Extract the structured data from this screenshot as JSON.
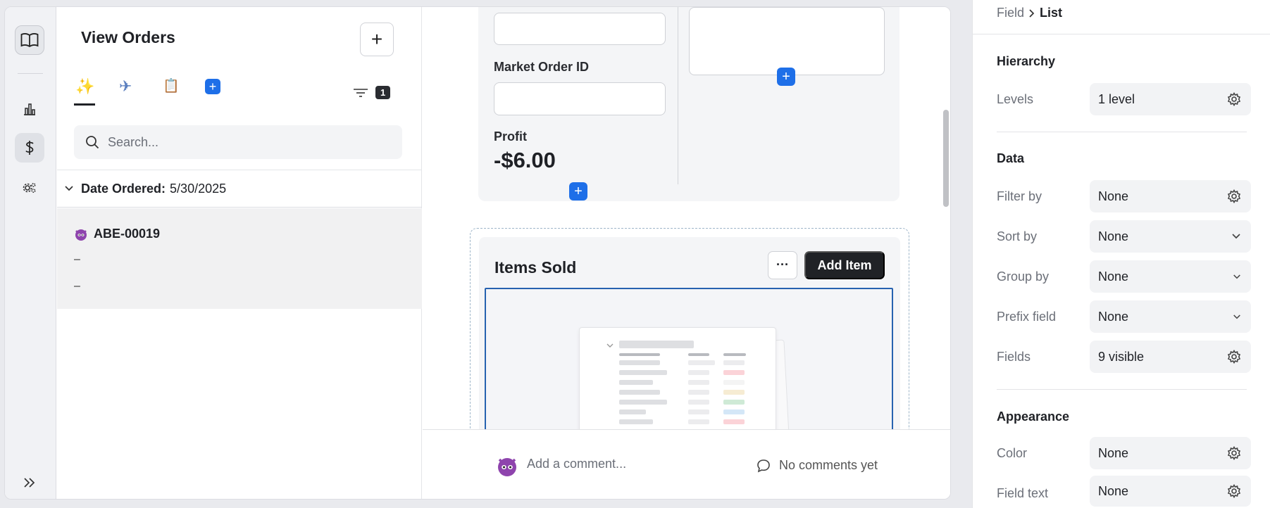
{
  "list_panel": {
    "title": "View Orders",
    "tabs": [
      {
        "icon": "sparkles-icon",
        "glyph": "✨",
        "active": true
      },
      {
        "icon": "airplane-icon",
        "glyph": "✈",
        "active": false
      },
      {
        "icon": "clipboard-icon",
        "glyph": "📋",
        "active": false
      }
    ],
    "add_tab_label": "+",
    "filter_count": "1",
    "search_placeholder": "Search...",
    "group": {
      "label": "Date Ordered:",
      "value": "5/30/2025"
    },
    "records": [
      {
        "name": "ABE-00019",
        "line1": "–",
        "line2": "–"
      }
    ]
  },
  "detail": {
    "market_order_label": "Market Order ID",
    "profit_label": "Profit",
    "profit_value": "-$6.00",
    "items_title": "Items Sold",
    "more_label": "···",
    "add_item_label": "Add Item"
  },
  "comments": {
    "placeholder": "Add a comment...",
    "empty_text": "No comments yet"
  },
  "props": {
    "breadcrumb": {
      "parent": "Field",
      "current": "List"
    },
    "sections": {
      "hierarchy": "Hierarchy",
      "data": "Data",
      "appearance": "Appearance"
    },
    "rows": {
      "levels": {
        "label": "Levels",
        "value": "1 level",
        "control": "gear"
      },
      "filter_by": {
        "label": "Filter by",
        "value": "None",
        "control": "gear"
      },
      "sort_by": {
        "label": "Sort by",
        "value": "None",
        "control": "chevron"
      },
      "group_by": {
        "label": "Group by",
        "value": "None",
        "control": "chevron"
      },
      "prefix_field": {
        "label": "Prefix field",
        "value": "None",
        "control": "chevron"
      },
      "fields": {
        "label": "Fields",
        "value": "9 visible",
        "control": "gear"
      },
      "color": {
        "label": "Color",
        "value": "None",
        "control": "gear"
      },
      "field_text": {
        "label": "Field text",
        "value": "None",
        "control": "gear"
      }
    }
  },
  "colors": {
    "accent": "#1e6fe8",
    "dark_button": "#202226",
    "preview_border": "#2662b0"
  }
}
